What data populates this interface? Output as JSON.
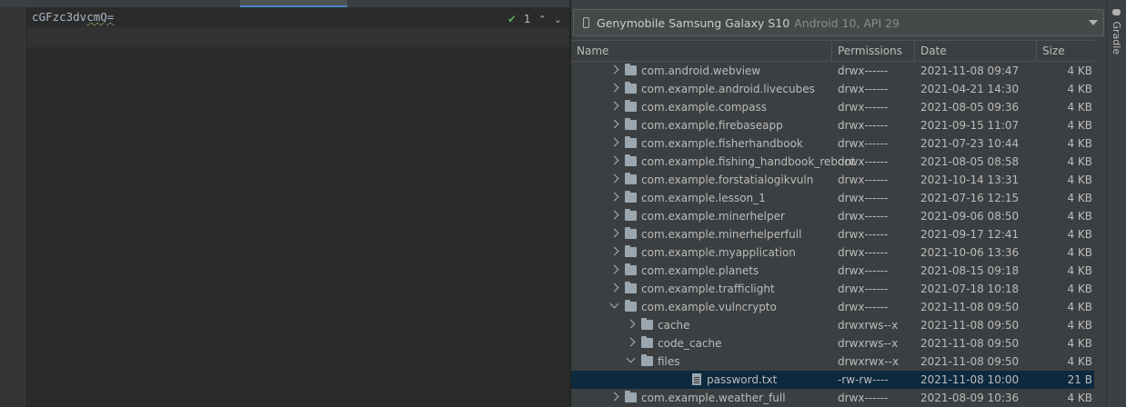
{
  "editor": {
    "code_text_a": "cGFzc3dv",
    "code_text_b": "cmQ=",
    "inspection_count": "1"
  },
  "device_explorer": {
    "device_name": "Genymobile Samsung Galaxy S10",
    "device_api": "Android 10, API 29",
    "columns": {
      "name": "Name",
      "permissions": "Permissions",
      "date": "Date",
      "size": "Size"
    },
    "rows": [
      {
        "name": "com.android.webview",
        "permissions": "drwx------",
        "date": "2021-11-08 09:47",
        "size": "4 KB",
        "depth": 0,
        "type": "folder",
        "expanded": false
      },
      {
        "name": "com.example.android.livecubes",
        "permissions": "drwx------",
        "date": "2021-04-21 14:30",
        "size": "4 KB",
        "depth": 0,
        "type": "folder",
        "expanded": false
      },
      {
        "name": "com.example.compass",
        "permissions": "drwx------",
        "date": "2021-08-05 09:36",
        "size": "4 KB",
        "depth": 0,
        "type": "folder",
        "expanded": false
      },
      {
        "name": "com.example.firebaseapp",
        "permissions": "drwx------",
        "date": "2021-09-15 11:07",
        "size": "4 KB",
        "depth": 0,
        "type": "folder",
        "expanded": false
      },
      {
        "name": "com.example.fisherhandbook",
        "permissions": "drwx------",
        "date": "2021-07-23 10:44",
        "size": "4 KB",
        "depth": 0,
        "type": "folder",
        "expanded": false
      },
      {
        "name": "com.example.fishing_handbook_reboot",
        "permissions": "drwx------",
        "date": "2021-08-05 08:58",
        "size": "4 KB",
        "depth": 0,
        "type": "folder",
        "expanded": false
      },
      {
        "name": "com.example.forstatialogikvuln",
        "permissions": "drwx------",
        "date": "2021-10-14 13:31",
        "size": "4 KB",
        "depth": 0,
        "type": "folder",
        "expanded": false
      },
      {
        "name": "com.example.lesson_1",
        "permissions": "drwx------",
        "date": "2021-07-16 12:15",
        "size": "4 KB",
        "depth": 0,
        "type": "folder",
        "expanded": false
      },
      {
        "name": "com.example.minerhelper",
        "permissions": "drwx------",
        "date": "2021-09-06 08:50",
        "size": "4 KB",
        "depth": 0,
        "type": "folder",
        "expanded": false
      },
      {
        "name": "com.example.minerhelperfull",
        "permissions": "drwx------",
        "date": "2021-09-17 12:41",
        "size": "4 KB",
        "depth": 0,
        "type": "folder",
        "expanded": false
      },
      {
        "name": "com.example.myapplication",
        "permissions": "drwx------",
        "date": "2021-10-06 13:36",
        "size": "4 KB",
        "depth": 0,
        "type": "folder",
        "expanded": false
      },
      {
        "name": "com.example.planets",
        "permissions": "drwx------",
        "date": "2021-08-15 09:18",
        "size": "4 KB",
        "depth": 0,
        "type": "folder",
        "expanded": false
      },
      {
        "name": "com.example.trafficlight",
        "permissions": "drwx------",
        "date": "2021-07-18 10:18",
        "size": "4 KB",
        "depth": 0,
        "type": "folder",
        "expanded": false
      },
      {
        "name": "com.example.vulncrypto",
        "permissions": "drwx------",
        "date": "2021-11-08 09:50",
        "size": "4 KB",
        "depth": 0,
        "type": "folder",
        "expanded": true
      },
      {
        "name": "cache",
        "permissions": "drwxrws--x",
        "date": "2021-11-08 09:50",
        "size": "4 KB",
        "depth": 1,
        "type": "folder",
        "expanded": false
      },
      {
        "name": "code_cache",
        "permissions": "drwxrws--x",
        "date": "2021-11-08 09:50",
        "size": "4 KB",
        "depth": 1,
        "type": "folder",
        "expanded": false
      },
      {
        "name": "files",
        "permissions": "drwxrwx--x",
        "date": "2021-11-08 09:50",
        "size": "4 KB",
        "depth": 1,
        "type": "folder",
        "expanded": true
      },
      {
        "name": "password.txt",
        "permissions": "-rw-rw----",
        "date": "2021-11-08 10:00",
        "size": "21 B",
        "depth": 2,
        "type": "file",
        "selected": true
      },
      {
        "name": "com.example.weather_full",
        "permissions": "drwx------",
        "date": "2021-08-09 10:36",
        "size": "4 KB",
        "depth": 0,
        "type": "folder",
        "expanded": false
      }
    ]
  },
  "tool_stripe": {
    "gradle_label": "Gradle"
  },
  "icons": {
    "phone": "phone-icon",
    "dropdown": "chevron-down-icon",
    "folder": "folder-icon",
    "file": "text-file-icon",
    "inspection_ok": "check-icon",
    "gradle": "gradle-icon"
  },
  "colors": {
    "selection": "#0d293e",
    "accent": "#4a88c7",
    "check_green": "#59a869"
  }
}
